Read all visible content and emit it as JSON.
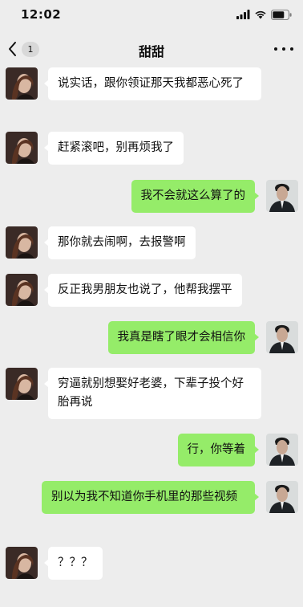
{
  "status": {
    "time": "12:02"
  },
  "nav": {
    "badge": "1",
    "title": "甜甜"
  },
  "messages": [
    {
      "side": "left",
      "text": "说实话，跟你领证那天我都恶心死了"
    },
    {
      "side": "left",
      "text": "赶紧滚吧，别再烦我了"
    },
    {
      "side": "right",
      "text": "我不会就这么算了的"
    },
    {
      "side": "left",
      "text": "那你就去闹啊，去报警啊"
    },
    {
      "side": "left",
      "text": "反正我男朋友也说了，他帮我摆平"
    },
    {
      "side": "right",
      "text": "我真是瞎了眼才会相信你"
    },
    {
      "side": "left",
      "text": "穷逼就别想娶好老婆，下辈子投个好胎再说"
    },
    {
      "side": "right",
      "text": "行，你等着"
    },
    {
      "side": "right",
      "text": "别以为我不知道你手机里的那些视频"
    },
    {
      "side": "left",
      "text": "？？？"
    }
  ]
}
